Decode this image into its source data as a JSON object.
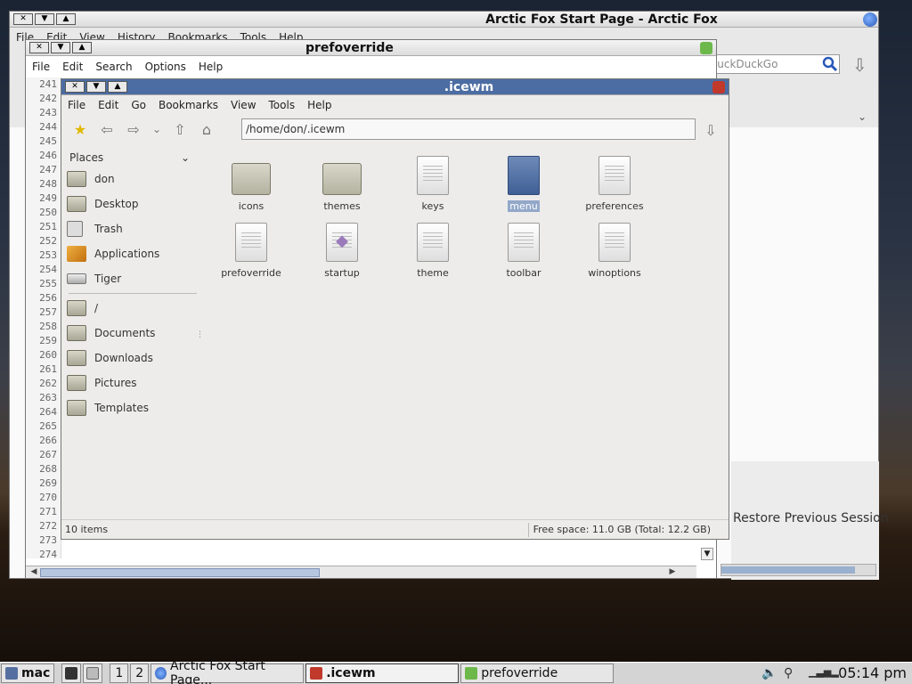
{
  "firefox": {
    "title": "Arctic Fox Start Page - Arctic Fox",
    "menu": [
      "File",
      "Edit",
      "View",
      "History",
      "Bookmarks",
      "Tools",
      "Help"
    ],
    "search_placeholder": "DuckDuckGo",
    "restore_label": "Restore Previous Session"
  },
  "editor": {
    "title": "prefoverride",
    "menu": [
      "File",
      "Edit",
      "Search",
      "Options",
      "Help"
    ],
    "line_numbers": [
      "241",
      "242",
      "243",
      "244",
      "245",
      "246",
      "247",
      "248",
      "249",
      "250",
      "251",
      "252",
      "253",
      "254",
      "255",
      "256",
      "257",
      "258",
      "259",
      "260",
      "261",
      "262",
      "263",
      "264",
      "265",
      "266",
      "267",
      "268",
      "269",
      "270",
      "271",
      "272",
      "273",
      "274"
    ]
  },
  "filemanager": {
    "title": ".icewm",
    "menu": [
      "File",
      "Edit",
      "Go",
      "Bookmarks",
      "View",
      "Tools",
      "Help"
    ],
    "path": "/home/don/.icewm",
    "places_label": "Places",
    "places": [
      {
        "label": "don",
        "icon": "home-icon"
      },
      {
        "label": "Desktop",
        "icon": "desktop-icon"
      },
      {
        "label": "Trash",
        "icon": "trash-icon"
      },
      {
        "label": "Applications",
        "icon": "applications-icon"
      },
      {
        "label": "Tiger",
        "icon": "drive-icon"
      }
    ],
    "bookmarks": [
      {
        "label": "/"
      },
      {
        "label": "Documents"
      },
      {
        "label": "Downloads"
      },
      {
        "label": "Pictures"
      },
      {
        "label": "Templates"
      }
    ],
    "files": [
      {
        "name": "icons",
        "type": "folder"
      },
      {
        "name": "themes",
        "type": "folder"
      },
      {
        "name": "keys",
        "type": "doc"
      },
      {
        "name": "menu",
        "type": "doc",
        "selected": true
      },
      {
        "name": "preferences",
        "type": "doc"
      },
      {
        "name": "prefoverride",
        "type": "doc"
      },
      {
        "name": "startup",
        "type": "exec"
      },
      {
        "name": "theme",
        "type": "doc"
      },
      {
        "name": "toolbar",
        "type": "doc"
      },
      {
        "name": "winoptions",
        "type": "doc"
      }
    ],
    "status_items": "10 items",
    "status_space": "Free space: 11.0 GB (Total: 12.2 GB)"
  },
  "taskbar": {
    "start_label": "mac",
    "workspaces": [
      "1",
      "2"
    ],
    "tasks": [
      {
        "label": "Arctic Fox Start Page...",
        "active": false
      },
      {
        "label": ".icewm",
        "active": true
      },
      {
        "label": "prefoverride",
        "active": false
      }
    ],
    "clock": "05:14 pm"
  }
}
